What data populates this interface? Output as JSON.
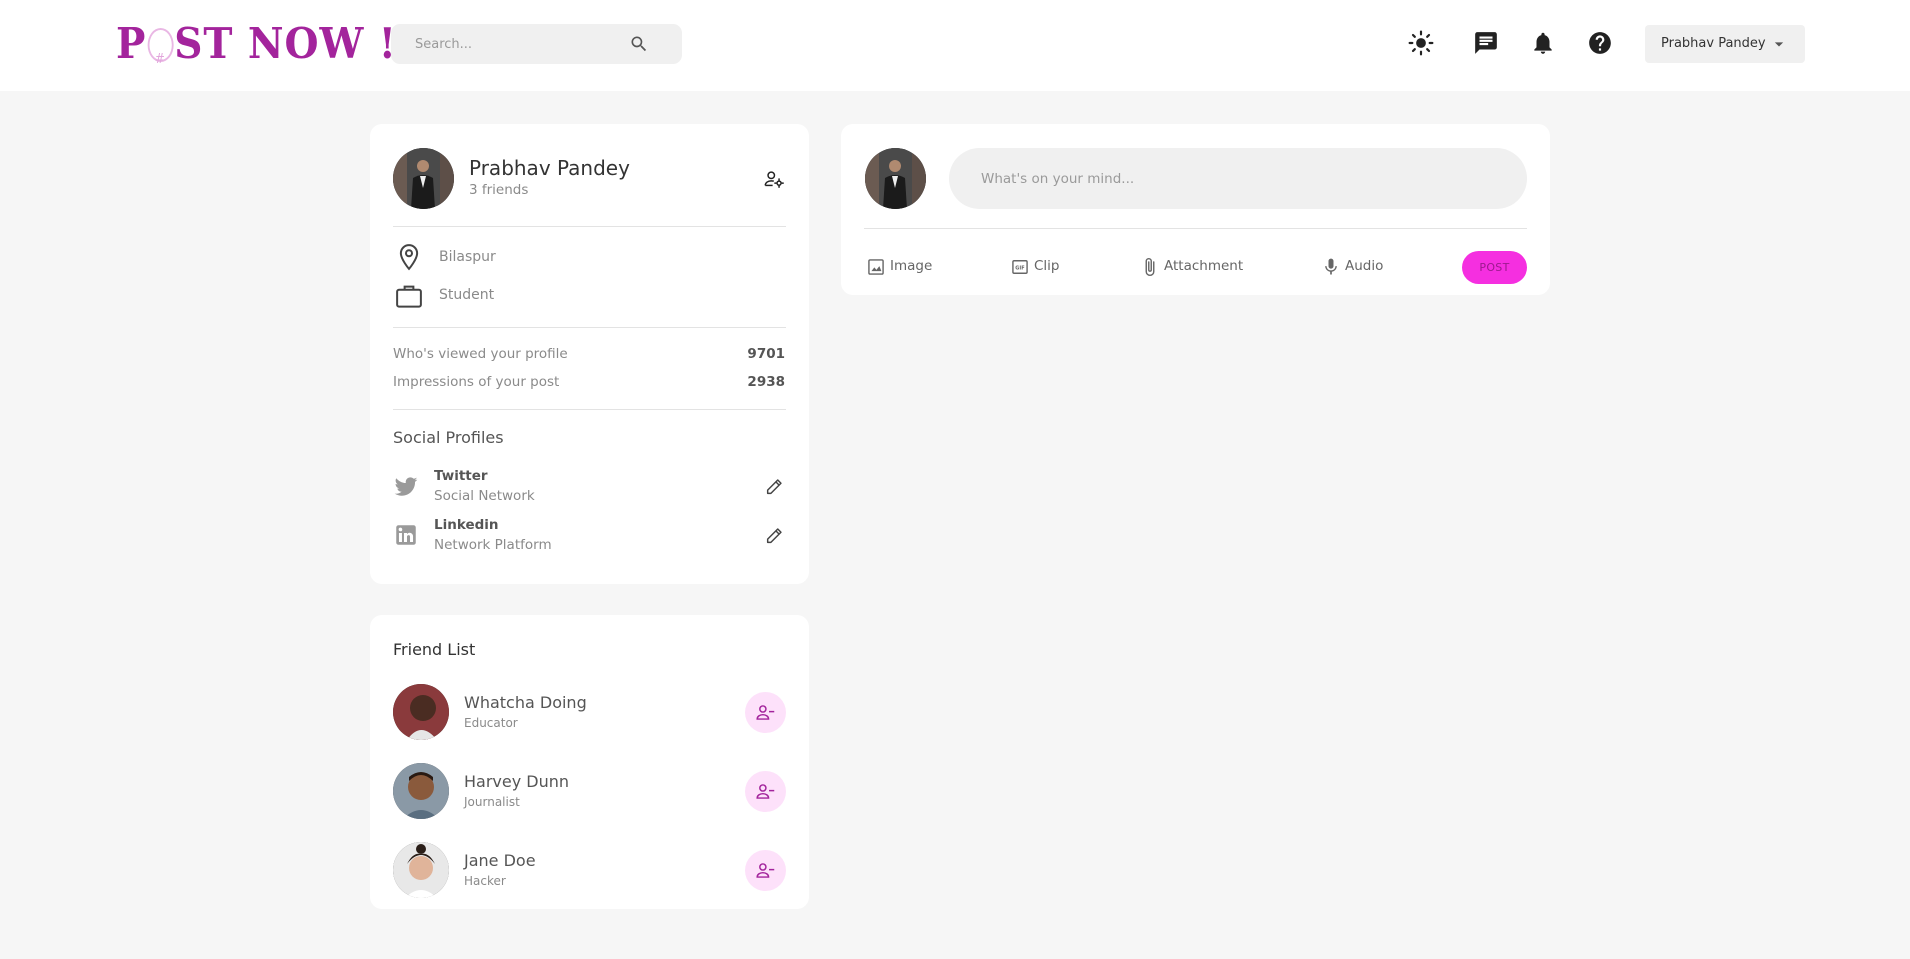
{
  "header": {
    "logo_left": "P",
    "logo_right": "ST NOW !",
    "search_placeholder": "Search...",
    "user_menu_label": "Prabhav Pandey"
  },
  "profile": {
    "name": "Prabhav Pandey",
    "friends_count": "3 friends",
    "location": "Bilaspur",
    "occupation": "Student",
    "stats": [
      {
        "label": "Who's viewed your profile",
        "value": "9701"
      },
      {
        "label": "Impressions of your post",
        "value": "2938"
      }
    ],
    "social_title": "Social Profiles",
    "socials": [
      {
        "name": "Twitter",
        "sub": "Social Network"
      },
      {
        "name": "Linkedin",
        "sub": "Network Platform"
      }
    ]
  },
  "friends": {
    "title": "Friend List",
    "items": [
      {
        "name": "Whatcha Doing",
        "occupation": "Educator"
      },
      {
        "name": "Harvey Dunn",
        "occupation": "Journalist"
      },
      {
        "name": "Jane Doe",
        "occupation": "Hacker"
      }
    ]
  },
  "composer": {
    "placeholder": "What's on your mind...",
    "actions": [
      "Image",
      "Clip",
      "Attachment",
      "Audio"
    ],
    "post_label": "POST"
  },
  "colors": {
    "brand": "#a3249c",
    "post_button": "#f52fe0",
    "remove_friend_bg": "#fde1fa",
    "page_bg": "#f6f6f6"
  },
  "icons": {
    "nav": [
      "light-mode-icon",
      "message-icon",
      "notifications-icon",
      "help-icon"
    ],
    "profile": [
      "manage-accounts-icon",
      "location-pin-icon",
      "briefcase-icon",
      "twitter-icon",
      "linkedin-icon",
      "edit-pencil-icon"
    ],
    "composer": [
      "image-icon",
      "gif-box-icon",
      "paperclip-icon",
      "microphone-icon"
    ],
    "friend": "person-remove-icon"
  }
}
